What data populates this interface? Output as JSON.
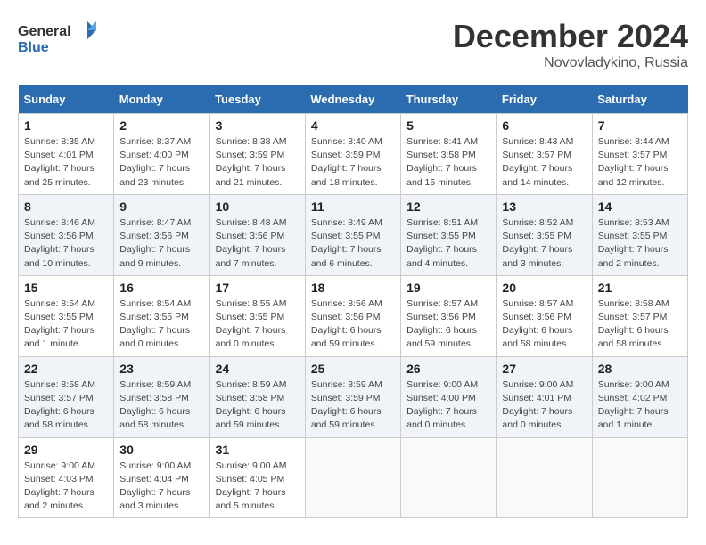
{
  "header": {
    "logo_line1": "General",
    "logo_line2": "Blue",
    "month": "December 2024",
    "location": "Novovladykino, Russia"
  },
  "days_of_week": [
    "Sunday",
    "Monday",
    "Tuesday",
    "Wednesday",
    "Thursday",
    "Friday",
    "Saturday"
  ],
  "weeks": [
    [
      {
        "day": "1",
        "info": "Sunrise: 8:35 AM\nSunset: 4:01 PM\nDaylight: 7 hours\nand 25 minutes."
      },
      {
        "day": "2",
        "info": "Sunrise: 8:37 AM\nSunset: 4:00 PM\nDaylight: 7 hours\nand 23 minutes."
      },
      {
        "day": "3",
        "info": "Sunrise: 8:38 AM\nSunset: 3:59 PM\nDaylight: 7 hours\nand 21 minutes."
      },
      {
        "day": "4",
        "info": "Sunrise: 8:40 AM\nSunset: 3:59 PM\nDaylight: 7 hours\nand 18 minutes."
      },
      {
        "day": "5",
        "info": "Sunrise: 8:41 AM\nSunset: 3:58 PM\nDaylight: 7 hours\nand 16 minutes."
      },
      {
        "day": "6",
        "info": "Sunrise: 8:43 AM\nSunset: 3:57 PM\nDaylight: 7 hours\nand 14 minutes."
      },
      {
        "day": "7",
        "info": "Sunrise: 8:44 AM\nSunset: 3:57 PM\nDaylight: 7 hours\nand 12 minutes."
      }
    ],
    [
      {
        "day": "8",
        "info": "Sunrise: 8:46 AM\nSunset: 3:56 PM\nDaylight: 7 hours\nand 10 minutes."
      },
      {
        "day": "9",
        "info": "Sunrise: 8:47 AM\nSunset: 3:56 PM\nDaylight: 7 hours\nand 9 minutes."
      },
      {
        "day": "10",
        "info": "Sunrise: 8:48 AM\nSunset: 3:56 PM\nDaylight: 7 hours\nand 7 minutes."
      },
      {
        "day": "11",
        "info": "Sunrise: 8:49 AM\nSunset: 3:55 PM\nDaylight: 7 hours\nand 6 minutes."
      },
      {
        "day": "12",
        "info": "Sunrise: 8:51 AM\nSunset: 3:55 PM\nDaylight: 7 hours\nand 4 minutes."
      },
      {
        "day": "13",
        "info": "Sunrise: 8:52 AM\nSunset: 3:55 PM\nDaylight: 7 hours\nand 3 minutes."
      },
      {
        "day": "14",
        "info": "Sunrise: 8:53 AM\nSunset: 3:55 PM\nDaylight: 7 hours\nand 2 minutes."
      }
    ],
    [
      {
        "day": "15",
        "info": "Sunrise: 8:54 AM\nSunset: 3:55 PM\nDaylight: 7 hours\nand 1 minute."
      },
      {
        "day": "16",
        "info": "Sunrise: 8:54 AM\nSunset: 3:55 PM\nDaylight: 7 hours\nand 0 minutes."
      },
      {
        "day": "17",
        "info": "Sunrise: 8:55 AM\nSunset: 3:55 PM\nDaylight: 7 hours\nand 0 minutes."
      },
      {
        "day": "18",
        "info": "Sunrise: 8:56 AM\nSunset: 3:56 PM\nDaylight: 6 hours\nand 59 minutes."
      },
      {
        "day": "19",
        "info": "Sunrise: 8:57 AM\nSunset: 3:56 PM\nDaylight: 6 hours\nand 59 minutes."
      },
      {
        "day": "20",
        "info": "Sunrise: 8:57 AM\nSunset: 3:56 PM\nDaylight: 6 hours\nand 58 minutes."
      },
      {
        "day": "21",
        "info": "Sunrise: 8:58 AM\nSunset: 3:57 PM\nDaylight: 6 hours\nand 58 minutes."
      }
    ],
    [
      {
        "day": "22",
        "info": "Sunrise: 8:58 AM\nSunset: 3:57 PM\nDaylight: 6 hours\nand 58 minutes."
      },
      {
        "day": "23",
        "info": "Sunrise: 8:59 AM\nSunset: 3:58 PM\nDaylight: 6 hours\nand 58 minutes."
      },
      {
        "day": "24",
        "info": "Sunrise: 8:59 AM\nSunset: 3:58 PM\nDaylight: 6 hours\nand 59 minutes."
      },
      {
        "day": "25",
        "info": "Sunrise: 8:59 AM\nSunset: 3:59 PM\nDaylight: 6 hours\nand 59 minutes."
      },
      {
        "day": "26",
        "info": "Sunrise: 9:00 AM\nSunset: 4:00 PM\nDaylight: 7 hours\nand 0 minutes."
      },
      {
        "day": "27",
        "info": "Sunrise: 9:00 AM\nSunset: 4:01 PM\nDaylight: 7 hours\nand 0 minutes."
      },
      {
        "day": "28",
        "info": "Sunrise: 9:00 AM\nSunset: 4:02 PM\nDaylight: 7 hours\nand 1 minute."
      }
    ],
    [
      {
        "day": "29",
        "info": "Sunrise: 9:00 AM\nSunset: 4:03 PM\nDaylight: 7 hours\nand 2 minutes."
      },
      {
        "day": "30",
        "info": "Sunrise: 9:00 AM\nSunset: 4:04 PM\nDaylight: 7 hours\nand 3 minutes."
      },
      {
        "day": "31",
        "info": "Sunrise: 9:00 AM\nSunset: 4:05 PM\nDaylight: 7 hours\nand 5 minutes."
      },
      {
        "day": "",
        "info": ""
      },
      {
        "day": "",
        "info": ""
      },
      {
        "day": "",
        "info": ""
      },
      {
        "day": "",
        "info": ""
      }
    ]
  ]
}
